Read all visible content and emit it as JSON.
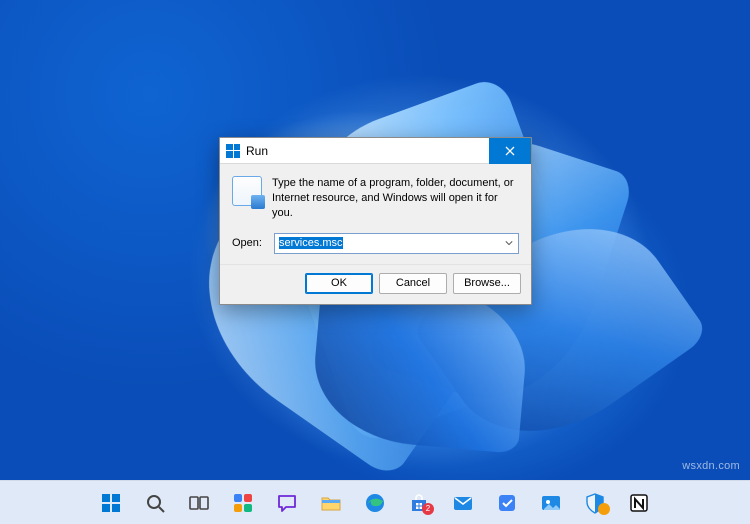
{
  "run_dialog": {
    "title": "Run",
    "description": "Type the name of a program, folder, document, or Internet resource, and Windows will open it for you.",
    "open_label": "Open:",
    "input_value": "services.msc",
    "buttons": {
      "ok": "OK",
      "cancel": "Cancel",
      "browse": "Browse..."
    }
  },
  "taskbar": {
    "items": [
      {
        "name": "start",
        "badge": ""
      },
      {
        "name": "search",
        "badge": ""
      },
      {
        "name": "task-view",
        "badge": ""
      },
      {
        "name": "widgets",
        "badge": ""
      },
      {
        "name": "chat",
        "badge": ""
      },
      {
        "name": "file-explorer",
        "badge": ""
      },
      {
        "name": "edge",
        "badge": ""
      },
      {
        "name": "store",
        "badge": "2"
      },
      {
        "name": "mail",
        "badge": ""
      },
      {
        "name": "todo",
        "badge": ""
      },
      {
        "name": "photos",
        "badge": ""
      },
      {
        "name": "security",
        "badge": " "
      },
      {
        "name": "notion",
        "badge": ""
      }
    ]
  },
  "watermark": "wsxdn.com"
}
